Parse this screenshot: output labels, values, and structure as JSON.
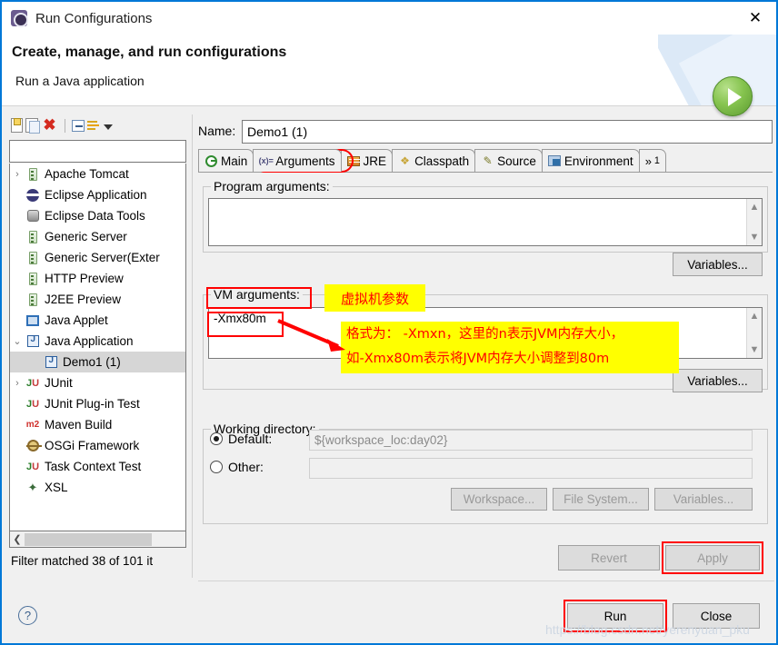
{
  "window": {
    "title": "Run Configurations",
    "close_label": "✕",
    "header_title": "Create, manage, and run configurations",
    "header_subtitle": "Run a Java application"
  },
  "tree_toolbar": {
    "new_icon": "new-configuration-icon",
    "duplicate_icon": "duplicate-icon",
    "delete_icon": "delete-icon",
    "collapse_icon": "collapse-all-icon",
    "filter_icon": "filter-icon",
    "menu_icon": "view-menu-arrow-icon"
  },
  "filter": {
    "value": "",
    "placeholder": "",
    "status": "Filter matched 38 of 101 it"
  },
  "tree": {
    "items": [
      {
        "label": "Apache Tomcat",
        "icon": "server-icon",
        "twisty": "›",
        "indent": 0,
        "selected": false
      },
      {
        "label": "Eclipse Application",
        "icon": "eclipse-icon",
        "twisty": "",
        "indent": 0,
        "selected": false
      },
      {
        "label": "Eclipse Data Tools",
        "icon": "database-icon",
        "twisty": "",
        "indent": 0,
        "selected": false
      },
      {
        "label": "Generic Server",
        "icon": "server-icon",
        "twisty": "",
        "indent": 0,
        "selected": false
      },
      {
        "label": "Generic Server(Exter",
        "icon": "server-icon",
        "twisty": "",
        "indent": 0,
        "selected": false
      },
      {
        "label": "HTTP Preview",
        "icon": "server-icon",
        "twisty": "",
        "indent": 0,
        "selected": false
      },
      {
        "label": "J2EE Preview",
        "icon": "server-icon",
        "twisty": "",
        "indent": 0,
        "selected": false
      },
      {
        "label": "Java Applet",
        "icon": "java-applet-icon",
        "twisty": "",
        "indent": 0,
        "selected": false
      },
      {
        "label": "Java Application",
        "icon": "java-app-icon",
        "twisty": "⌄",
        "indent": 0,
        "selected": false
      },
      {
        "label": "Demo1 (1)",
        "icon": "java-app-icon",
        "twisty": "",
        "indent": 1,
        "selected": true
      },
      {
        "label": "JUnit",
        "icon": "junit-icon",
        "twisty": "›",
        "indent": 0,
        "selected": false
      },
      {
        "label": "JUnit Plug-in Test",
        "icon": "junit-plugin-icon",
        "twisty": "",
        "indent": 0,
        "selected": false
      },
      {
        "label": "Maven Build",
        "icon": "maven-icon",
        "twisty": "",
        "indent": 0,
        "selected": false
      },
      {
        "label": "OSGi Framework",
        "icon": "osgi-icon",
        "twisty": "",
        "indent": 0,
        "selected": false
      },
      {
        "label": "Task Context Test",
        "icon": "task-context-icon",
        "twisty": "",
        "indent": 0,
        "selected": false
      },
      {
        "label": "XSL",
        "icon": "xsl-icon",
        "twisty": "",
        "indent": 0,
        "selected": false
      }
    ]
  },
  "config": {
    "name_label": "Name:",
    "name_value": "Demo1 (1)"
  },
  "tabs": [
    {
      "label": "Main",
      "icon": "main-tab-icon",
      "active": false
    },
    {
      "label": "Arguments",
      "icon": "arguments-tab-icon",
      "active": true
    },
    {
      "label": "JRE",
      "icon": "jre-tab-icon",
      "active": false
    },
    {
      "label": "Classpath",
      "icon": "classpath-tab-icon",
      "active": false
    },
    {
      "label": "Source",
      "icon": "source-tab-icon",
      "active": false
    },
    {
      "label": "Environment",
      "icon": "environment-tab-icon",
      "active": false
    }
  ],
  "tabs_overflow": {
    "chevrons": "»",
    "count": "1"
  },
  "program_arguments": {
    "legend": "Program arguments:",
    "value": "",
    "variables_label": "Variables..."
  },
  "vm_arguments": {
    "legend": "VM arguments:",
    "value": "-Xmx80m",
    "variables_label": "Variables..."
  },
  "working_directory": {
    "legend": "Working directory:",
    "default_label": "Default:",
    "default_value": "${workspace_loc:day02}",
    "other_label": "Other:",
    "other_value": "",
    "selected": "default",
    "workspace_label": "Workspace...",
    "file_system_label": "File System...",
    "variables_label": "Variables..."
  },
  "buttons": {
    "revert": "Revert",
    "apply": "Apply",
    "run": "Run",
    "close": "Close",
    "help_icon": "help-icon",
    "help_glyph": "?"
  },
  "annotations": {
    "vm_label_note": "虚拟机参数",
    "format_note_line1": "格式为： -Xmxn，这里的n表示JVM内存大小，",
    "format_note_line2": "如-Xmx80m表示将JVM内存大小调整到80m",
    "highlight_color": "#ff0000",
    "highlight_background": "#ffff00"
  },
  "watermark": {
    "text": "https://blog.csdn.net/yerenyuan_pku"
  }
}
